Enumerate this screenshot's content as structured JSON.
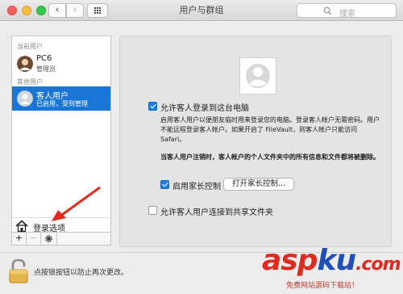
{
  "window": {
    "title": "用户与群组"
  },
  "toolbar": {
    "search_placeholder": "搜索"
  },
  "sidebar": {
    "current_users_heading": "当前用户",
    "current_user": {
      "name": "PC6",
      "role": "管理员"
    },
    "other_users_heading": "其他用户",
    "guest_user": {
      "name": "客人用户",
      "status": "已启用，受到管理"
    },
    "login_options_label": "登录选项",
    "add_label": "+",
    "remove_label": "−"
  },
  "guest_settings": {
    "allow_login_label": "允许客人登录到这台电脑",
    "allow_login_checked": true,
    "description": "启用客人用户以便朋友临时用来登录您的电脑。登录客人帐户无需密码。用户不能远程登录客人帐户。如果开启了 FileVault，则客人帐户只能访问 Safari。",
    "logout_warning": "当客人用户注销时，客人帐户的个人文件夹中的所有信息和文件都将被删除。",
    "parental_controls_label": "启用家长控制",
    "parental_controls_checked": true,
    "open_parental_controls_button": "打开家长控制...",
    "shared_folders_label": "允许客人用户连接到共享文件夹",
    "shared_folders_checked": false
  },
  "footer": {
    "lock_text": "点按锁按钮以防止再次更改。"
  },
  "watermark": {
    "brand_a": "asp",
    "brand_b": "ku",
    "brand_c": ".com",
    "subtitle": "免费网站源码下载站！"
  },
  "colors": {
    "accent": "#1a76d6",
    "watermark_red": "#e02a1e",
    "watermark_blue": "#1f4fb8"
  }
}
